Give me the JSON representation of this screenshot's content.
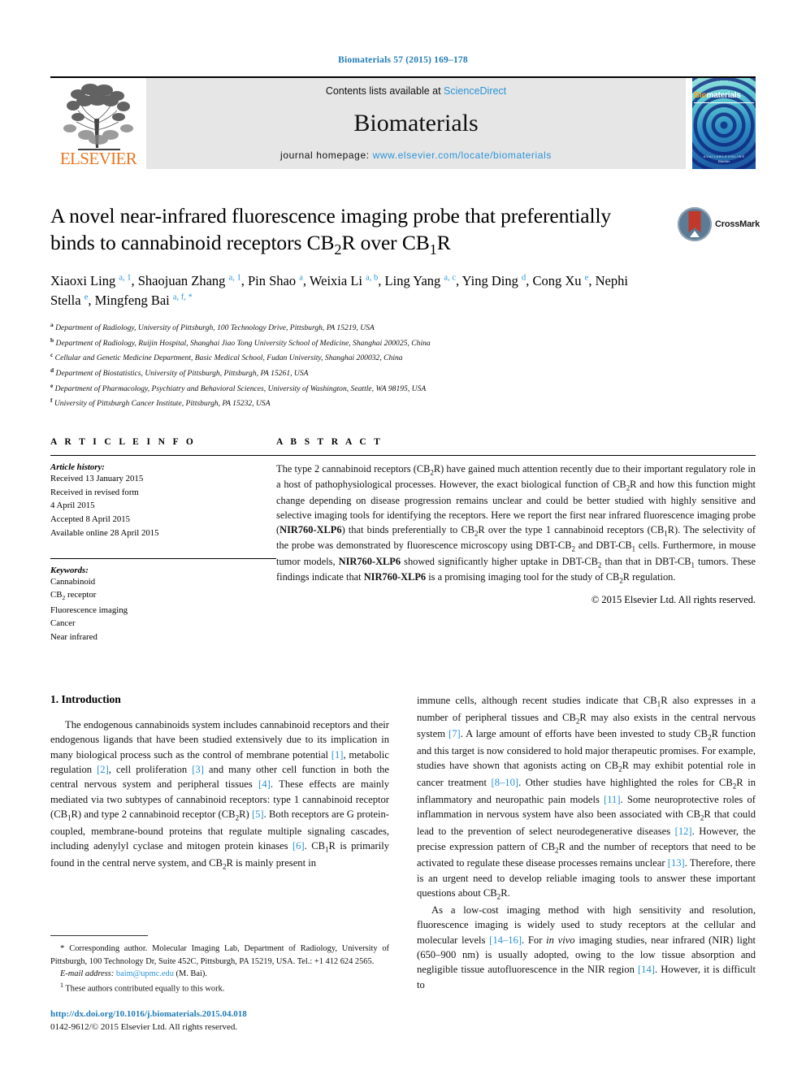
{
  "running_head": "Biomaterials 57 (2015) 169–178",
  "masthead": {
    "publisher": "ELSEVIER",
    "contents_prefix": "Contents lists available at ",
    "contents_link": "ScienceDirect",
    "journal_name": "Biomaterials",
    "homepage_label": "journal homepage:",
    "homepage_url": "www.elsevier.com/locate/biomaterials",
    "cover": {
      "title_left": "Bio",
      "title_right": "materials",
      "footer_line1": "A V A I L A B L E   O N L I N E",
      "footer_line2": "Elsevier"
    }
  },
  "title": {
    "line1": "A novel near-infrared fluorescence imaging probe that preferentially",
    "line2_pre": "binds to cannabinoid receptors CB",
    "line2_sub1": "2",
    "line2_mid": "R over CB",
    "line2_sub2": "1",
    "line2_post": "R",
    "crossmark_label": "CrossMark"
  },
  "authors": [
    {
      "name": "Xiaoxi Ling",
      "marks": "a, 1",
      "sep": ", "
    },
    {
      "name": "Shaojuan Zhang",
      "marks": "a, 1",
      "sep": ", "
    },
    {
      "name": "Pin Shao",
      "marks": "a",
      "sep": ", "
    },
    {
      "name": "Weixia Li",
      "marks": "a, b",
      "sep": ", "
    },
    {
      "name": "Ling Yang",
      "marks": "a, c",
      "sep": ", "
    },
    {
      "name": "Ying Ding",
      "marks": "d",
      "sep": ", "
    },
    {
      "name": "Cong Xu",
      "marks": "e",
      "sep": ", "
    },
    {
      "name": "Nephi Stella",
      "marks": "e",
      "sep": ", "
    },
    {
      "name": "Mingfeng Bai",
      "marks": "a, f, *",
      "sep": ""
    }
  ],
  "affiliations": [
    {
      "mark": "a",
      "text": "Department of Radiology, University of Pittsburgh, 100 Technology Drive, Pittsburgh, PA 15219, USA"
    },
    {
      "mark": "b",
      "text": "Department of Radiology, Ruijin Hospital, Shanghai Jiao Tong University School of Medicine, Shanghai 200025, China"
    },
    {
      "mark": "c",
      "text": "Cellular and Genetic Medicine Department, Basic Medical School, Fudan University, Shanghai 200032, China"
    },
    {
      "mark": "d",
      "text": "Department of Biostatistics, University of Pittsburgh, Pittsburgh, PA 15261, USA"
    },
    {
      "mark": "e",
      "text": "Department of Pharmacology, Psychiatry and Behavioral Sciences, University of Washington, Seattle, WA 98195, USA"
    },
    {
      "mark": "f",
      "text": "University of Pittsburgh Cancer Institute, Pittsburgh, PA 15232, USA"
    }
  ],
  "article_info": {
    "heading": "A R T I C L E   I N F O",
    "history_title": "Article history:",
    "history": [
      "Received 13 January 2015",
      "Received in revised form",
      "4 April 2015",
      "Accepted 8 April 2015",
      "Available online 28 April 2015"
    ],
    "keywords_title": "Keywords:",
    "keywords": [
      "Cannabinoid",
      "CB2 receptor",
      "Fluorescence imaging",
      "Cancer",
      "Near infrared"
    ]
  },
  "abstract": {
    "heading": "A B S T R A C T",
    "copyright": "© 2015 Elsevier Ltd. All rights reserved."
  },
  "introduction": {
    "heading": "1.  Introduction"
  },
  "footnotes": {
    "corresponding_star": "*",
    "corresponding": "Corresponding author. Molecular Imaging Lab, Department of Radiology, University of Pittsburgh, 100 Technology Dr, Suite 452C, Pittsburgh, PA 15219, USA. Tel.: +1 412 624 2565.",
    "email_label": "E-mail address:",
    "email": "baim@upmc.edu",
    "email_suffix": "(M. Bai).",
    "equal_mark": "1",
    "equal_contrib": "These authors contributed equally to this work."
  },
  "footer": {
    "doi": "http://dx.doi.org/10.1016/j.biomaterials.2015.04.018",
    "issn": "0142-9612/© 2015 Elsevier Ltd. All rights reserved."
  },
  "colors": {
    "link_blue": "#2a93d5",
    "header_blue": "#1f7bb6",
    "elsevier_orange": "#E87722",
    "box_gray": "#e6e6e6"
  }
}
